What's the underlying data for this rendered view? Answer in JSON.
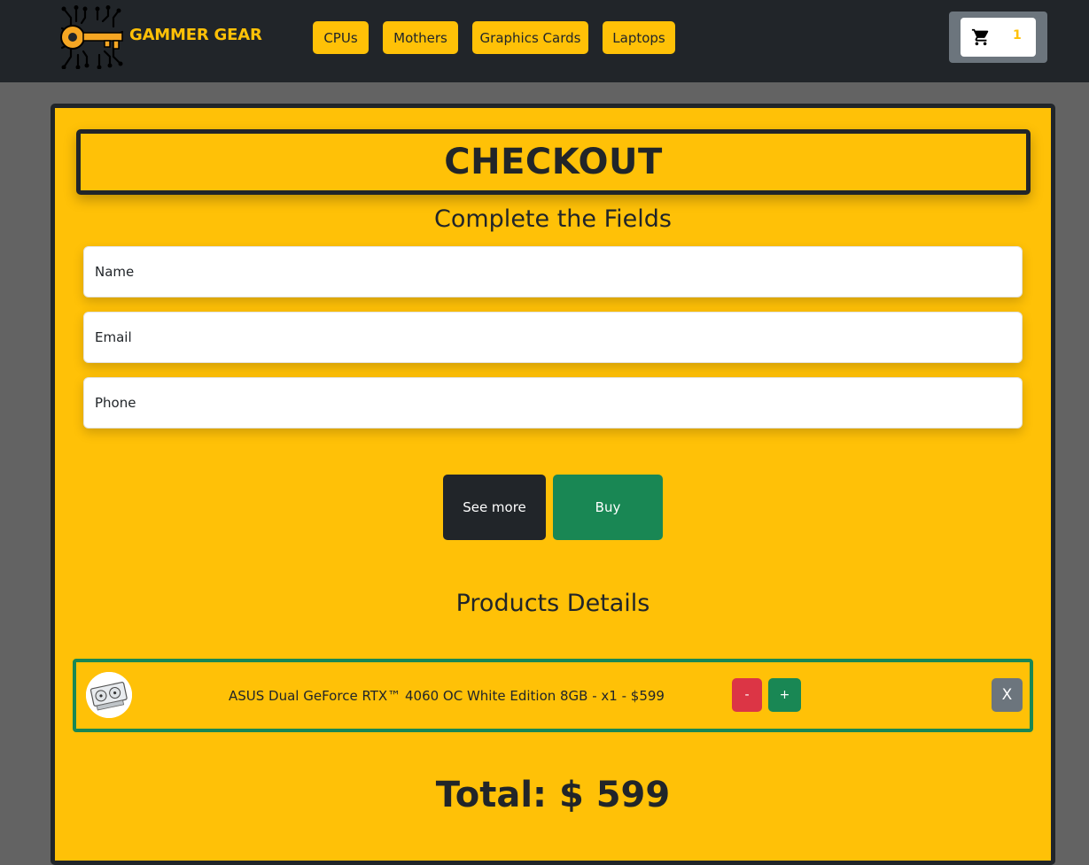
{
  "header": {
    "brand": "GAMMER GEAR",
    "nav": [
      "CPUs",
      "Mothers",
      "Graphics Cards",
      "Laptops"
    ],
    "cart_icon": "shopping-cart-icon",
    "cart_count": "1"
  },
  "checkout": {
    "title": "CHECKOUT",
    "subtitle": "Complete the Fields",
    "fields": {
      "name_placeholder": "Name",
      "email_placeholder": "Email",
      "phone_placeholder": "Phone"
    },
    "see_more_label": "See more",
    "buy_label": "Buy",
    "products_title": "Products Details",
    "products": [
      {
        "text": "ASUS Dual GeForce RTX™ 4060 OC White Edition 8GB - x1 - $599",
        "minus": "-",
        "plus": "+",
        "remove": "X"
      }
    ],
    "total": "Total: $ 599"
  },
  "colors": {
    "accent": "#ffc107",
    "dark": "#212529",
    "success": "#198754",
    "danger": "#dc3545",
    "secondary": "#6c757d"
  }
}
